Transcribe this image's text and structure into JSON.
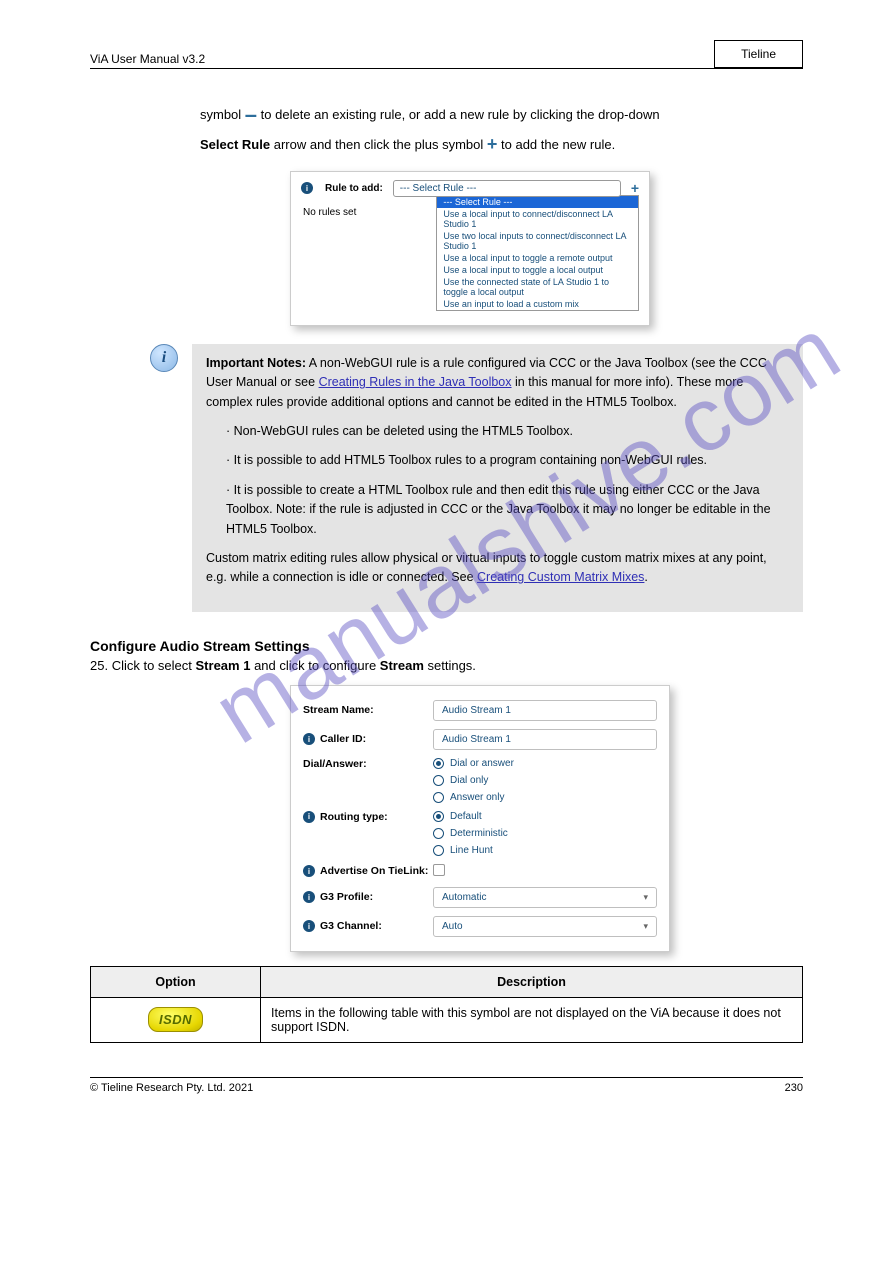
{
  "header": {
    "left": "ViA User Manual v3.2",
    "right": "Tieline"
  },
  "intro": {
    "line1_a": "symbol ",
    "line1_b": " to delete an existing rule, or add a new rule by clicking the drop-down ",
    "line2_a": "Select Rule",
    "line2_b": " arrow and then click the plus symbol ",
    "line2_c": " to add the new rule."
  },
  "dropdown": {
    "label": "Rule to add:",
    "placeholder": "--- Select Rule ---",
    "options": [
      "--- Select Rule ---",
      "Use a local input to connect/disconnect LA Studio 1",
      "Use two local inputs to connect/disconnect LA Studio 1",
      "Use a local input to toggle a remote output",
      "Use a local input to toggle a local output",
      "Use the connected state of LA Studio 1 to toggle a local output",
      "Use an input to load a custom mix"
    ],
    "empty": "No rules set"
  },
  "note": {
    "heading": "Important Notes:",
    "p1_a": "A non-WebGUI rule is a rule configured via CCC or the Java Toolbox (see the CCC User Manual or see ",
    "p1_link": "Creating Rules in the Java Toolbox",
    "p1_b": " in this manual for more info). These more complex rules provide additional options and cannot be edited in the HTML5 Toolbox.",
    "bullets": [
      "Non-WebGUI rules can be deleted using the HTML5 Toolbox.",
      "It is possible to add HTML5 Toolbox rules to a program containing non-WebGUI rules.",
      "It is possible to create a HTML Toolbox rule and then edit this rule using either CCC or the Java Toolbox. Note: if the rule is adjusted in CCC or the Java Toolbox it may no longer be editable in the HTML5 Toolbox."
    ],
    "p2_a": "Custom matrix editing rules allow physical or virtual inputs to toggle custom matrix mixes at any point, e.g. while a connection is idle or connected. See ",
    "p2_link": "Creating Custom Matrix Mixes",
    "p2_b": "."
  },
  "streams": {
    "heading": "Configure Audio Stream Settings",
    "intro_num": "25.",
    "intro_a": "Click to select ",
    "intro_b": " and click to configure ",
    "intro_c": " settings.",
    "stream_ref": "Stream 1",
    "stream_panel": "Stream"
  },
  "panel": {
    "stream_name": {
      "label": "Stream Name:",
      "value": "Audio Stream 1"
    },
    "caller_id": {
      "label": "Caller ID:",
      "value": "Audio Stream 1"
    },
    "dial_answer": {
      "label": "Dial/Answer:",
      "options": [
        "Dial or answer",
        "Dial only",
        "Answer only"
      ]
    },
    "routing": {
      "label": "Routing type:",
      "options": [
        "Default",
        "Deterministic",
        "Line Hunt"
      ]
    },
    "advertise": {
      "label": "Advertise On TieLink:"
    },
    "g3_profile": {
      "label": "G3 Profile:",
      "value": "Automatic"
    },
    "g3_channel": {
      "label": "G3 Channel:",
      "value": "Auto"
    }
  },
  "table": {
    "col1": "Option",
    "col2": "Description",
    "row1_badge": "ISDN",
    "row1_desc": "Items in the following table with this symbol are not displayed on the ViA because it does not support ISDN."
  },
  "footer": {
    "left": "© Tieline Research Pty. Ltd. 2021",
    "right": "230"
  },
  "icons": {
    "info": "i",
    "chevron": "▾"
  },
  "watermark": "manualshive.com"
}
